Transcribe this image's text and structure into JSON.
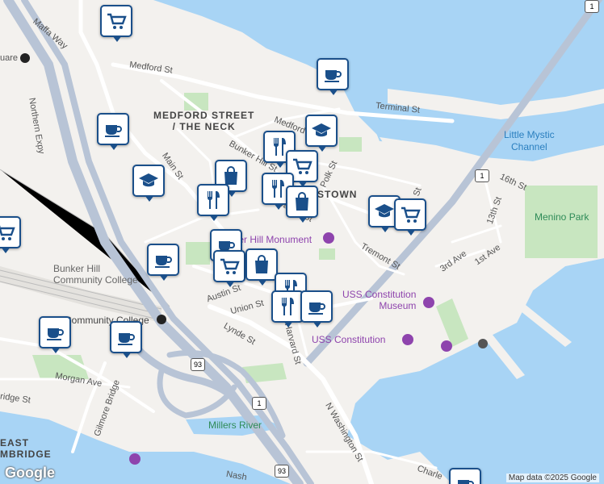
{
  "map": {
    "street_labels": [
      {
        "id": "medford-st-1",
        "text": "Medford St"
      },
      {
        "id": "medford-st-2",
        "text": "Medford St"
      },
      {
        "id": "maffa-way",
        "text": "Maffa Way"
      },
      {
        "id": "northern-expy",
        "text": "Northern Expy"
      },
      {
        "id": "terminal-st",
        "text": "Terminal St"
      },
      {
        "id": "bunker-hill-st",
        "text": "Bunker Hill St"
      },
      {
        "id": "main-st",
        "text": "Main St"
      },
      {
        "id": "polk-st",
        "text": "Polk St"
      },
      {
        "id": "warren-st",
        "text": "Warren St"
      },
      {
        "id": "tremont-st",
        "text": "Tremont St"
      },
      {
        "id": "austin-st",
        "text": "Austin St"
      },
      {
        "id": "union-st",
        "text": "Union St"
      },
      {
        "id": "lynde-st",
        "text": "Lynde St"
      },
      {
        "id": "harvard-st",
        "text": "Harvard St"
      },
      {
        "id": "morgan-ave",
        "text": "Morgan Ave"
      },
      {
        "id": "gilmore-bridge",
        "text": "Gilmore Bridge"
      },
      {
        "id": "n-washington-st",
        "text": "N Washington St"
      },
      {
        "id": "16th-st",
        "text": "16th St"
      },
      {
        "id": "13th-st",
        "text": "13th St"
      },
      {
        "id": "3rd-ave",
        "text": "3rd Ave"
      },
      {
        "id": "1st-ave",
        "text": "1st Ave"
      },
      {
        "id": "bridge-st",
        "text": "ridge St"
      },
      {
        "id": "nash",
        "text": "Nash"
      },
      {
        "id": "charles",
        "text": "Charle"
      },
      {
        "id": "uare",
        "text": "uare"
      },
      {
        "id": "s-st",
        "text": "St"
      }
    ],
    "neighborhoods": [
      {
        "id": "medford-street-neck",
        "line1": "MEDFORD STREET",
        "line2": "/ THE NECK"
      },
      {
        "id": "charlestown",
        "line1": "STOWN",
        "line2": ""
      },
      {
        "id": "east-cambridge",
        "line1": "EAST",
        "line2": "MBRIDGE"
      }
    ],
    "poi_labels": [
      {
        "id": "bunker-hill-cc",
        "text": "Bunker Hill\nCommunity College"
      },
      {
        "id": "community-college-station",
        "text": "Community College"
      },
      {
        "id": "bunker-hill-monument",
        "text": "Bunker Hill Monument"
      },
      {
        "id": "uss-constitution-museum",
        "text": "USS Constitution\nMuseum"
      },
      {
        "id": "uss-constitution",
        "text": "USS Constitution"
      }
    ],
    "water_labels": [
      {
        "id": "little-mystic",
        "text": "Little Mystic\nChannel"
      }
    ],
    "park_labels": [
      {
        "id": "menino-park",
        "text": "Menino Park"
      },
      {
        "id": "millers-river",
        "text": "Millers River"
      }
    ],
    "route_shields": [
      "1",
      "1",
      "93",
      "93",
      "1"
    ],
    "markers": [
      {
        "id": "m1",
        "icon": "cart-icon"
      },
      {
        "id": "m2",
        "icon": "coffee-icon"
      },
      {
        "id": "m3",
        "icon": "graduation-cap-icon"
      },
      {
        "id": "m4",
        "icon": "coffee-icon"
      },
      {
        "id": "m5",
        "icon": "utensils-icon"
      },
      {
        "id": "m6",
        "icon": "cart-icon"
      },
      {
        "id": "m7",
        "icon": "graduation-cap-icon"
      },
      {
        "id": "m8",
        "icon": "bag-icon"
      },
      {
        "id": "m9",
        "icon": "utensils-icon"
      },
      {
        "id": "m10",
        "icon": "utensils-icon"
      },
      {
        "id": "m11",
        "icon": "bag-icon"
      },
      {
        "id": "m12",
        "icon": "graduation-cap-icon"
      },
      {
        "id": "m13",
        "icon": "cart-icon"
      },
      {
        "id": "m14",
        "icon": "coffee-icon"
      },
      {
        "id": "m15",
        "icon": "coffee-icon"
      },
      {
        "id": "m16",
        "icon": "cart-icon"
      },
      {
        "id": "m17",
        "icon": "bag-icon"
      },
      {
        "id": "m18",
        "icon": "utensils-icon"
      },
      {
        "id": "m19",
        "icon": "utensils-icon"
      },
      {
        "id": "m20",
        "icon": "coffee-icon"
      },
      {
        "id": "m21",
        "icon": "coffee-icon"
      },
      {
        "id": "m22",
        "icon": "coffee-icon"
      },
      {
        "id": "m23",
        "icon": "cart-icon"
      },
      {
        "id": "m24",
        "icon": "coffee-icon"
      }
    ],
    "colors": {
      "water": "#a8d4f5",
      "land": "#f3f1ee",
      "road": "#ffffff",
      "highway": "#b8c4d6",
      "park": "#c8e6c0",
      "rail": "#a6a6a6",
      "marker_border": "#1a4f8a",
      "poi": "#8e44ad"
    }
  },
  "footer": {
    "google_logo": "Google",
    "map_data": "Map data ©2025 Google"
  }
}
